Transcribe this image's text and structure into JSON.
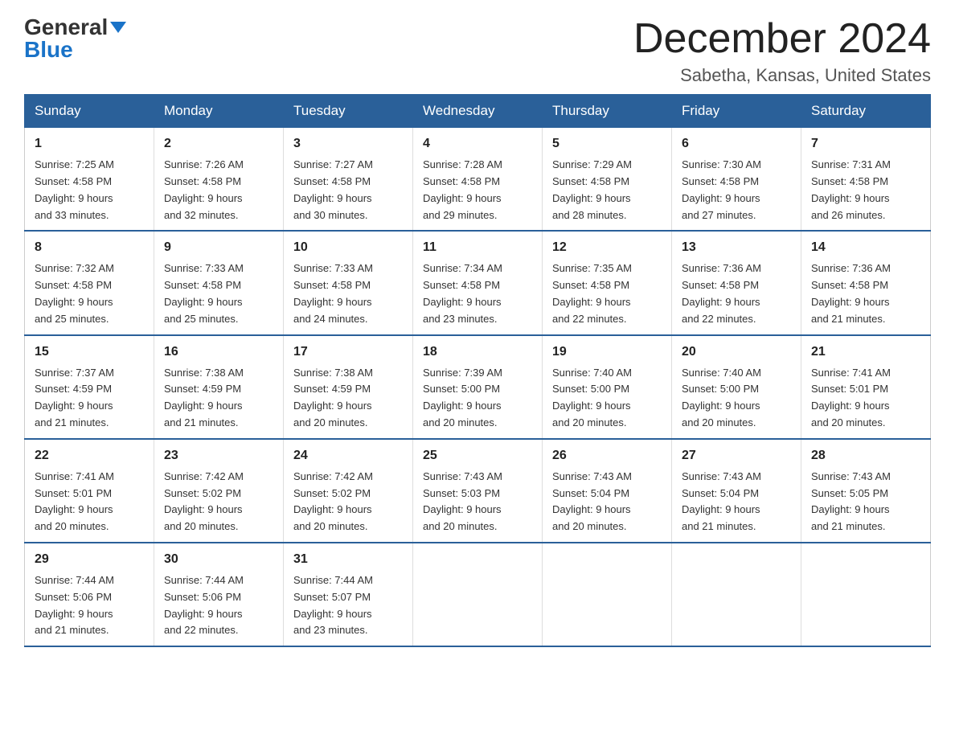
{
  "logo": {
    "general": "General",
    "blue": "Blue"
  },
  "header": {
    "title": "December 2024",
    "subtitle": "Sabetha, Kansas, United States"
  },
  "weekdays": [
    "Sunday",
    "Monday",
    "Tuesday",
    "Wednesday",
    "Thursday",
    "Friday",
    "Saturday"
  ],
  "weeks": [
    [
      {
        "day": "1",
        "sunrise": "7:25 AM",
        "sunset": "4:58 PM",
        "daylight": "9 hours and 33 minutes."
      },
      {
        "day": "2",
        "sunrise": "7:26 AM",
        "sunset": "4:58 PM",
        "daylight": "9 hours and 32 minutes."
      },
      {
        "day": "3",
        "sunrise": "7:27 AM",
        "sunset": "4:58 PM",
        "daylight": "9 hours and 30 minutes."
      },
      {
        "day": "4",
        "sunrise": "7:28 AM",
        "sunset": "4:58 PM",
        "daylight": "9 hours and 29 minutes."
      },
      {
        "day": "5",
        "sunrise": "7:29 AM",
        "sunset": "4:58 PM",
        "daylight": "9 hours and 28 minutes."
      },
      {
        "day": "6",
        "sunrise": "7:30 AM",
        "sunset": "4:58 PM",
        "daylight": "9 hours and 27 minutes."
      },
      {
        "day": "7",
        "sunrise": "7:31 AM",
        "sunset": "4:58 PM",
        "daylight": "9 hours and 26 minutes."
      }
    ],
    [
      {
        "day": "8",
        "sunrise": "7:32 AM",
        "sunset": "4:58 PM",
        "daylight": "9 hours and 25 minutes."
      },
      {
        "day": "9",
        "sunrise": "7:33 AM",
        "sunset": "4:58 PM",
        "daylight": "9 hours and 25 minutes."
      },
      {
        "day": "10",
        "sunrise": "7:33 AM",
        "sunset": "4:58 PM",
        "daylight": "9 hours and 24 minutes."
      },
      {
        "day": "11",
        "sunrise": "7:34 AM",
        "sunset": "4:58 PM",
        "daylight": "9 hours and 23 minutes."
      },
      {
        "day": "12",
        "sunrise": "7:35 AM",
        "sunset": "4:58 PM",
        "daylight": "9 hours and 22 minutes."
      },
      {
        "day": "13",
        "sunrise": "7:36 AM",
        "sunset": "4:58 PM",
        "daylight": "9 hours and 22 minutes."
      },
      {
        "day": "14",
        "sunrise": "7:36 AM",
        "sunset": "4:58 PM",
        "daylight": "9 hours and 21 minutes."
      }
    ],
    [
      {
        "day": "15",
        "sunrise": "7:37 AM",
        "sunset": "4:59 PM",
        "daylight": "9 hours and 21 minutes."
      },
      {
        "day": "16",
        "sunrise": "7:38 AM",
        "sunset": "4:59 PM",
        "daylight": "9 hours and 21 minutes."
      },
      {
        "day": "17",
        "sunrise": "7:38 AM",
        "sunset": "4:59 PM",
        "daylight": "9 hours and 20 minutes."
      },
      {
        "day": "18",
        "sunrise": "7:39 AM",
        "sunset": "5:00 PM",
        "daylight": "9 hours and 20 minutes."
      },
      {
        "day": "19",
        "sunrise": "7:40 AM",
        "sunset": "5:00 PM",
        "daylight": "9 hours and 20 minutes."
      },
      {
        "day": "20",
        "sunrise": "7:40 AM",
        "sunset": "5:00 PM",
        "daylight": "9 hours and 20 minutes."
      },
      {
        "day": "21",
        "sunrise": "7:41 AM",
        "sunset": "5:01 PM",
        "daylight": "9 hours and 20 minutes."
      }
    ],
    [
      {
        "day": "22",
        "sunrise": "7:41 AM",
        "sunset": "5:01 PM",
        "daylight": "9 hours and 20 minutes."
      },
      {
        "day": "23",
        "sunrise": "7:42 AM",
        "sunset": "5:02 PM",
        "daylight": "9 hours and 20 minutes."
      },
      {
        "day": "24",
        "sunrise": "7:42 AM",
        "sunset": "5:02 PM",
        "daylight": "9 hours and 20 minutes."
      },
      {
        "day": "25",
        "sunrise": "7:43 AM",
        "sunset": "5:03 PM",
        "daylight": "9 hours and 20 minutes."
      },
      {
        "day": "26",
        "sunrise": "7:43 AM",
        "sunset": "5:04 PM",
        "daylight": "9 hours and 20 minutes."
      },
      {
        "day": "27",
        "sunrise": "7:43 AM",
        "sunset": "5:04 PM",
        "daylight": "9 hours and 21 minutes."
      },
      {
        "day": "28",
        "sunrise": "7:43 AM",
        "sunset": "5:05 PM",
        "daylight": "9 hours and 21 minutes."
      }
    ],
    [
      {
        "day": "29",
        "sunrise": "7:44 AM",
        "sunset": "5:06 PM",
        "daylight": "9 hours and 21 minutes."
      },
      {
        "day": "30",
        "sunrise": "7:44 AM",
        "sunset": "5:06 PM",
        "daylight": "9 hours and 22 minutes."
      },
      {
        "day": "31",
        "sunrise": "7:44 AM",
        "sunset": "5:07 PM",
        "daylight": "9 hours and 23 minutes."
      },
      null,
      null,
      null,
      null
    ]
  ],
  "labels": {
    "sunrise": "Sunrise:",
    "sunset": "Sunset:",
    "daylight": "Daylight:"
  }
}
